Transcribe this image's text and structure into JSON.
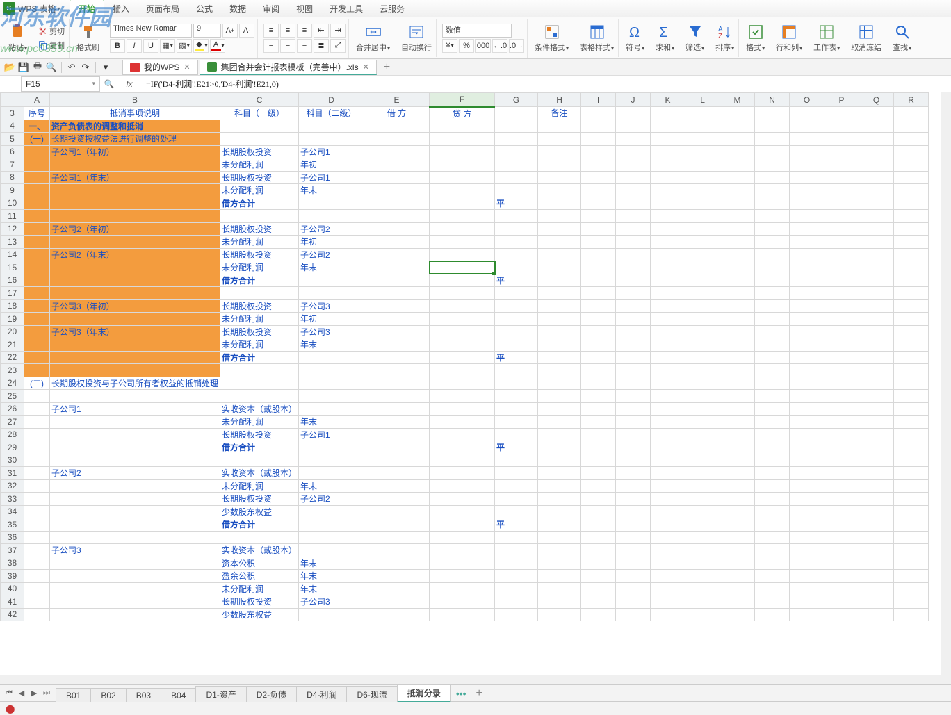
{
  "app": {
    "name": "WPS 表格",
    "dropdown": "▾"
  },
  "watermark": {
    "main": "河东软件园",
    "sub": "www.pc0359.cn"
  },
  "menus": [
    "开始",
    "插入",
    "页面布局",
    "公式",
    "数据",
    "审阅",
    "视图",
    "开发工具",
    "云服务"
  ],
  "menu_active_index": 0,
  "ribbon": {
    "paste": "粘贴",
    "cut": "剪切",
    "copy": "复制",
    "format_painter": "格式刷",
    "font_name": "Times New Romar",
    "font_size": "9",
    "merge_center": "合并居中",
    "wrap_text": "自动换行",
    "number_format": "数值",
    "cond_fmt": "条件格式",
    "table_style": "表格样式",
    "symbol": "符号",
    "sum": "求和",
    "filter": "筛选",
    "sort": "排序",
    "format": "格式",
    "rowcol": "行和列",
    "worksheet": "工作表",
    "unfreeze": "取消冻结",
    "find": "查找"
  },
  "qat_icons": [
    "open",
    "save",
    "print",
    "preview",
    "undo",
    "redo"
  ],
  "doc_tabs": [
    {
      "label": "我的WPS",
      "type": "wps",
      "active": false
    },
    {
      "label": "集团合并会计报表模板（完善中）.xls",
      "type": "xls",
      "active": true
    }
  ],
  "namebox": "F15",
  "formula": "=IF('D4-利润'!E21>0,'D4-利润'!E21,0)",
  "columns": [
    "A",
    "B",
    "C",
    "D",
    "E",
    "F",
    "G",
    "H",
    "I",
    "J",
    "K",
    "L",
    "M",
    "N",
    "O",
    "P",
    "Q",
    "R"
  ],
  "active_col": "F",
  "rows": [
    {
      "n": 3,
      "cells": {
        "A": "序号",
        "B": "抵消事项说明",
        "C": "科目（一级）",
        "D": "科目（二级）",
        "E": "借        方",
        "F": "贷        方",
        "H": "备注"
      },
      "style": "header",
      "orangeA": false,
      "orangeB": false
    },
    {
      "n": 4,
      "cells": {
        "A": "一、",
        "B": "资产负债表的调整和抵消"
      },
      "style": "bold",
      "orangeA": true,
      "orangeB": true,
      "center": true
    },
    {
      "n": 5,
      "cells": {
        "A": "(一)",
        "B": "长期投资按权益法进行调整的处理"
      },
      "orangeA": true,
      "orangeB": true,
      "overflow": true
    },
    {
      "n": 6,
      "cells": {
        "B": "子公司1（年初）",
        "C": "长期股权投资",
        "D": "子公司1"
      },
      "orangeA": true,
      "orangeB": true
    },
    {
      "n": 7,
      "cells": {
        "C": "未分配利润",
        "D": "年初"
      },
      "orangeA": true,
      "orangeB": true
    },
    {
      "n": 8,
      "cells": {
        "B": "子公司1（年末）",
        "C": "长期股权投资",
        "D": "子公司1"
      },
      "orangeA": true,
      "orangeB": true
    },
    {
      "n": 9,
      "cells": {
        "C": "未分配利润",
        "D": "年末"
      },
      "orangeA": true,
      "orangeB": true
    },
    {
      "n": 10,
      "cells": {
        "C": "借方合计",
        "G": "平"
      },
      "style": "bold",
      "orangeA": true,
      "orangeB": true,
      "indentC": true
    },
    {
      "n": 11,
      "cells": {},
      "orangeA": true,
      "orangeB": true
    },
    {
      "n": 12,
      "cells": {
        "B": "子公司2（年初）",
        "C": "长期股权投资",
        "D": "子公司2"
      },
      "orangeA": true,
      "orangeB": true
    },
    {
      "n": 13,
      "cells": {
        "C": "未分配利润",
        "D": "年初"
      },
      "orangeA": true,
      "orangeB": true
    },
    {
      "n": 14,
      "cells": {
        "B": "子公司2（年末）",
        "C": "长期股权投资",
        "D": "子公司2"
      },
      "orangeA": true,
      "orangeB": true
    },
    {
      "n": 15,
      "cells": {
        "C": "未分配利润",
        "D": "年末"
      },
      "orangeA": true,
      "orangeB": true,
      "selF": true
    },
    {
      "n": 16,
      "cells": {
        "C": "借方合计",
        "G": "平"
      },
      "style": "bold",
      "orangeA": true,
      "orangeB": true,
      "indentC": true
    },
    {
      "n": 17,
      "cells": {},
      "orangeA": true,
      "orangeB": true
    },
    {
      "n": 18,
      "cells": {
        "B": "子公司3（年初）",
        "C": "长期股权投资",
        "D": "子公司3"
      },
      "orangeA": true,
      "orangeB": true
    },
    {
      "n": 19,
      "cells": {
        "C": "未分配利润",
        "D": "年初"
      },
      "orangeA": true,
      "orangeB": true
    },
    {
      "n": 20,
      "cells": {
        "B": "子公司3（年末）",
        "C": "长期股权投资",
        "D": "子公司3"
      },
      "orangeA": true,
      "orangeB": true
    },
    {
      "n": 21,
      "cells": {
        "C": "未分配利润",
        "D": "年末"
      },
      "orangeA": true,
      "orangeB": true
    },
    {
      "n": 22,
      "cells": {
        "C": "借方合计",
        "G": "平"
      },
      "style": "bold",
      "orangeA": true,
      "orangeB": true,
      "indentC": true
    },
    {
      "n": 23,
      "cells": {},
      "orangeA": true,
      "orangeB": true
    },
    {
      "n": 24,
      "cells": {
        "A": "(二)",
        "B": "长期股权投资与子公司所有者权益的抵销处理"
      },
      "overflow": true
    },
    {
      "n": 25,
      "cells": {}
    },
    {
      "n": 26,
      "cells": {
        "B": "子公司1",
        "C": "实收资本（或股本）"
      }
    },
    {
      "n": 27,
      "cells": {
        "C": "未分配利润",
        "D": "年末"
      }
    },
    {
      "n": 28,
      "cells": {
        "C": "长期股权投资",
        "D": "子公司1"
      }
    },
    {
      "n": 29,
      "cells": {
        "C": "借方合计",
        "G": "平"
      },
      "style": "bold",
      "indentC": true
    },
    {
      "n": 30,
      "cells": {}
    },
    {
      "n": 31,
      "cells": {
        "B": "子公司2",
        "C": "实收资本（或股本）"
      }
    },
    {
      "n": 32,
      "cells": {
        "C": "未分配利润",
        "D": "年末"
      }
    },
    {
      "n": 33,
      "cells": {
        "C": "长期股权投资",
        "D": "子公司2"
      }
    },
    {
      "n": 34,
      "cells": {
        "C": "少数股东权益"
      }
    },
    {
      "n": 35,
      "cells": {
        "C": "借方合计",
        "G": "平"
      },
      "style": "bold",
      "indentC": true
    },
    {
      "n": 36,
      "cells": {}
    },
    {
      "n": 37,
      "cells": {
        "B": "子公司3",
        "C": "实收资本（或股本）"
      }
    },
    {
      "n": 38,
      "cells": {
        "C": "资本公积",
        "D": "年末"
      }
    },
    {
      "n": 39,
      "cells": {
        "C": "盈余公积",
        "D": "年末"
      }
    },
    {
      "n": 40,
      "cells": {
        "C": "未分配利润",
        "D": "年末"
      }
    },
    {
      "n": 41,
      "cells": {
        "C": "长期股权投资",
        "D": "子公司3"
      }
    },
    {
      "n": 42,
      "cells": {
        "C": "少数股东权益"
      }
    }
  ],
  "sheets": [
    "B01",
    "B02",
    "B03",
    "B04",
    "D1-资产",
    "D2-负债",
    "D4-利润",
    "D6-现流",
    "抵消分录"
  ],
  "active_sheet_index": 8
}
